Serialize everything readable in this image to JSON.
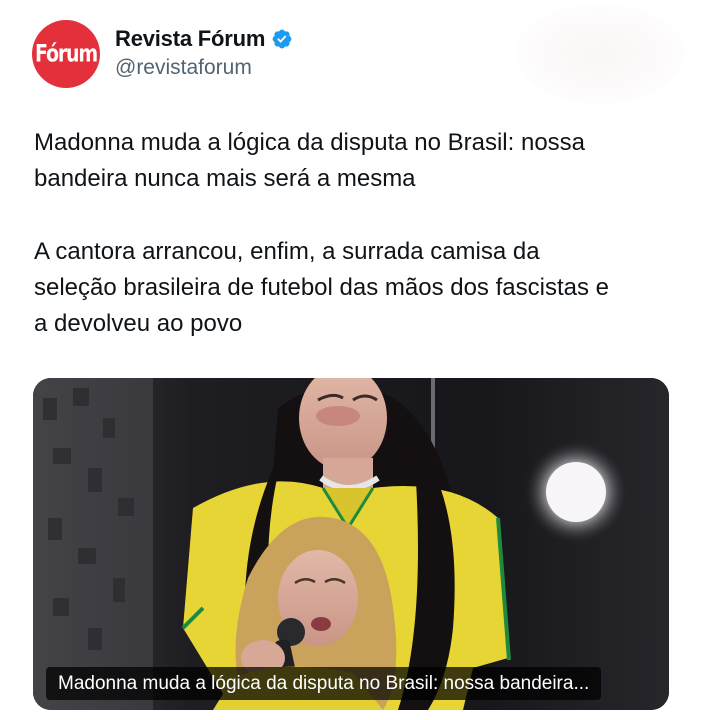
{
  "account": {
    "avatar_text": "Fórum",
    "display_name": "Revista Fórum",
    "handle": "@revistaforum",
    "verified_icon": "verified-badge-icon",
    "brand_color": "#e4303a",
    "verified_color": "#1d9bf0"
  },
  "tweet": {
    "text_line_1": "Madonna muda a lógica da disputa no Brasil: nossa\nbandeira nunca mais será a mesma",
    "text_line_2": "A cantora arrancou, enfim, a surrada camisa da\nseleção brasileira de futebol das mãos dos fascistas e\na devolveu ao povo"
  },
  "media": {
    "caption": "Madonna muda a lógica da disputa no Brasil: nossa bandeira..."
  }
}
